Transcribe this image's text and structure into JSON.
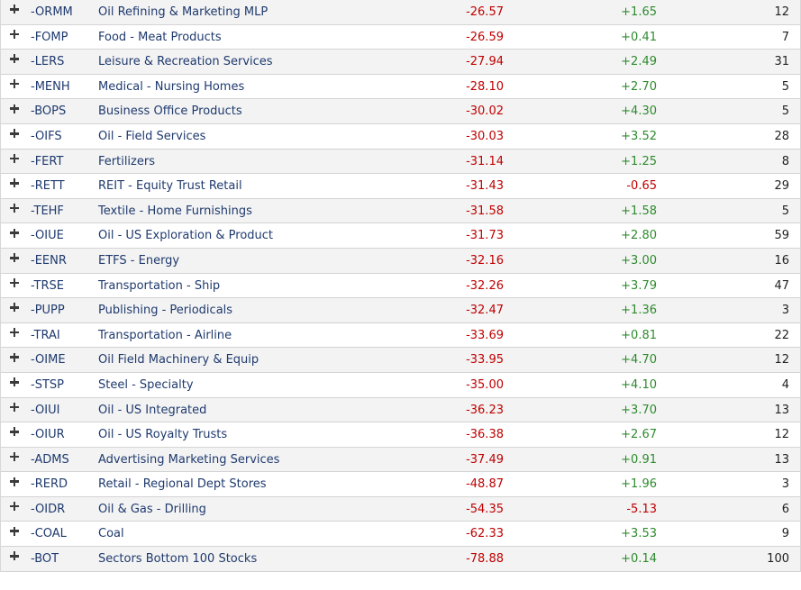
{
  "colors": {
    "negative": "#c00000",
    "positive": "#2e8b2e",
    "text": "#1f3a6e",
    "row_alt": "#f3f3f3"
  },
  "icons": {
    "expand": "plus-icon"
  },
  "rows": [
    {
      "symbol": "-ORMM",
      "name": "Oil Refining & Marketing MLP",
      "pct1": "-26.57",
      "pct2": "+1.65",
      "count": "12"
    },
    {
      "symbol": "-FOMP",
      "name": "Food - Meat Products",
      "pct1": "-26.59",
      "pct2": "+0.41",
      "count": "7"
    },
    {
      "symbol": "-LERS",
      "name": "Leisure & Recreation Services",
      "pct1": "-27.94",
      "pct2": "+2.49",
      "count": "31"
    },
    {
      "symbol": "-MENH",
      "name": "Medical - Nursing Homes",
      "pct1": "-28.10",
      "pct2": "+2.70",
      "count": "5"
    },
    {
      "symbol": "-BOPS",
      "name": "Business Office Products",
      "pct1": "-30.02",
      "pct2": "+4.30",
      "count": "5"
    },
    {
      "symbol": "-OIFS",
      "name": "Oil - Field Services",
      "pct1": "-30.03",
      "pct2": "+3.52",
      "count": "28"
    },
    {
      "symbol": "-FERT",
      "name": "Fertilizers",
      "pct1": "-31.14",
      "pct2": "+1.25",
      "count": "8"
    },
    {
      "symbol": "-RETT",
      "name": "REIT - Equity Trust Retail",
      "pct1": "-31.43",
      "pct2": "-0.65",
      "count": "29"
    },
    {
      "symbol": "-TEHF",
      "name": "Textile - Home Furnishings",
      "pct1": "-31.58",
      "pct2": "+1.58",
      "count": "5"
    },
    {
      "symbol": "-OIUE",
      "name": "Oil - US Exploration & Product",
      "pct1": "-31.73",
      "pct2": "+2.80",
      "count": "59"
    },
    {
      "symbol": "-EENR",
      "name": "ETFS - Energy",
      "pct1": "-32.16",
      "pct2": "+3.00",
      "count": "16"
    },
    {
      "symbol": "-TRSE",
      "name": "Transportation - Ship",
      "pct1": "-32.26",
      "pct2": "+3.79",
      "count": "47"
    },
    {
      "symbol": "-PUPP",
      "name": "Publishing - Periodicals",
      "pct1": "-32.47",
      "pct2": "+1.36",
      "count": "3"
    },
    {
      "symbol": "-TRAI",
      "name": "Transportation - Airline",
      "pct1": "-33.69",
      "pct2": "+0.81",
      "count": "22"
    },
    {
      "symbol": "-OIME",
      "name": "Oil Field Machinery & Equip",
      "pct1": "-33.95",
      "pct2": "+4.70",
      "count": "12"
    },
    {
      "symbol": "-STSP",
      "name": "Steel - Specialty",
      "pct1": "-35.00",
      "pct2": "+4.10",
      "count": "4"
    },
    {
      "symbol": "-OIUI",
      "name": "Oil - US Integrated",
      "pct1": "-36.23",
      "pct2": "+3.70",
      "count": "13"
    },
    {
      "symbol": "-OIUR",
      "name": "Oil - US Royalty Trusts",
      "pct1": "-36.38",
      "pct2": "+2.67",
      "count": "12"
    },
    {
      "symbol": "-ADMS",
      "name": "Advertising Marketing Services",
      "pct1": "-37.49",
      "pct2": "+0.91",
      "count": "13"
    },
    {
      "symbol": "-RERD",
      "name": "Retail - Regional Dept Stores",
      "pct1": "-48.87",
      "pct2": "+1.96",
      "count": "3"
    },
    {
      "symbol": "-OIDR",
      "name": "Oil & Gas - Drilling",
      "pct1": "-54.35",
      "pct2": "-5.13",
      "count": "6"
    },
    {
      "symbol": "-COAL",
      "name": "Coal",
      "pct1": "-62.33",
      "pct2": "+3.53",
      "count": "9"
    },
    {
      "symbol": "-BOT",
      "name": "Sectors Bottom 100 Stocks",
      "pct1": "-78.88",
      "pct2": "+0.14",
      "count": "100"
    }
  ]
}
